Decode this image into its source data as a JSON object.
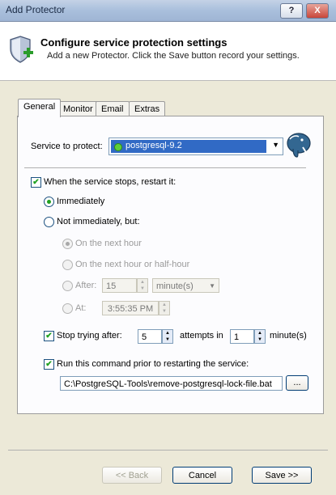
{
  "window": {
    "title": "Add Protector",
    "help_label": "?",
    "close_label": "X"
  },
  "header": {
    "title": "Configure service protection settings",
    "subtitle": "Add a new Protector. Click the Save button record your settings."
  },
  "tabs": [
    {
      "label": "General",
      "active": true
    },
    {
      "label": "Monitor",
      "active": false
    },
    {
      "label": "Email",
      "active": false
    },
    {
      "label": "Extras",
      "active": false
    }
  ],
  "general": {
    "service_label": "Service to protect:",
    "service_value": "postgresql-9.2",
    "restart_label": "When the service stops, restart it:",
    "restart_checked": true,
    "immediately_label": "Immediately",
    "immediately_selected": true,
    "not_immediately_label": "Not immediately, but:",
    "next_hour_label": "On the next hour",
    "next_half_hour_label": "On the next hour or half-hour",
    "after_label": "After:",
    "after_value": "15",
    "after_unit": "minute(s)",
    "at_label": "At:",
    "at_value": "3:55:35 PM",
    "stop_trying_label": "Stop trying after:",
    "stop_trying_checked": true,
    "attempts_value": "5",
    "attempts_in_label": "attempts in",
    "minutes_value": "1",
    "minutes_label": "minute(s)",
    "run_cmd_label": "Run this command prior to restarting the service:",
    "run_cmd_checked": true,
    "command_value": "C:\\PostgreSQL-Tools\\remove-postgresql-lock-file.bat",
    "browse_label": "..."
  },
  "footer": {
    "back_label": "<< Back",
    "cancel_label": "Cancel",
    "save_label": "Save >>"
  }
}
